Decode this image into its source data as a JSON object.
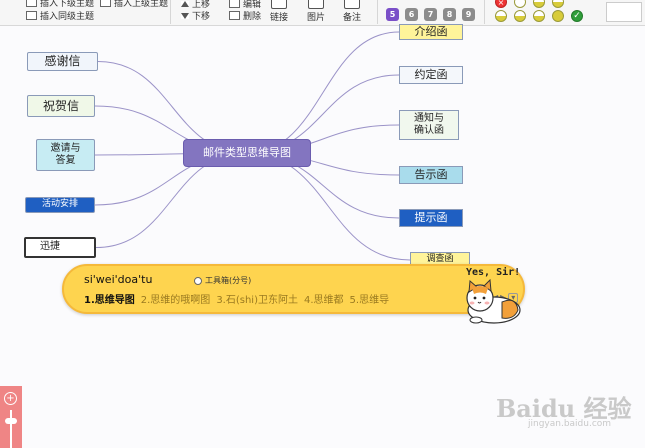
{
  "toolbar": {
    "insert_sub": "插入下级主题",
    "insert_parent": "插入上级主题",
    "insert_sibling": "插入同级主题",
    "move_up": "上移",
    "move_down": "下移",
    "edit": "编辑",
    "delete": "删除",
    "link": "链接",
    "image": "图片",
    "note": "备注",
    "priority": [
      "5",
      "6",
      "7",
      "8",
      "9"
    ],
    "priority_colors": [
      "#7a4fc8",
      "#8c8c8c",
      "#8c8c8c",
      "#8c8c8c",
      "#8c8c8c"
    ]
  },
  "mindmap": {
    "center": "邮件类型思维导图",
    "left": [
      "感谢信",
      "祝贺信",
      "邀请与\n答复",
      "活动安排",
      "迅捷"
    ],
    "right": [
      "介绍函",
      "约定函",
      "通知与\n确认函",
      "告示函",
      "提示函",
      "调查函"
    ]
  },
  "colors": {
    "center_bg": "#8375c0",
    "link": "#9b93c8",
    "left_fills": [
      "#f1f5fb",
      "#f0f8e8",
      "#c7ecf3",
      "#1f5fc2",
      "#ffffff"
    ],
    "right_fills": [
      "#fff49a",
      "#f4f7fb",
      "#f1f8ee",
      "#a9dcec",
      "#1f5fc2",
      "#fff49a"
    ]
  },
  "ime": {
    "composition": "si'wei'doa'tu",
    "toolbox": "工具箱(分号)",
    "candidates": [
      "1.思维导图",
      "2.思维的哦啊图",
      "3.石(shi)卫东阿土",
      "4.思维都",
      "5.思维导"
    ],
    "nav_prev": "◀",
    "nav_next": "▶",
    "mascot_text": "Yes, Sir!"
  },
  "zoom": {
    "plus": "+"
  },
  "watermark": {
    "brand": "Baidu 经验",
    "url": "jingyan.baidu.com"
  }
}
